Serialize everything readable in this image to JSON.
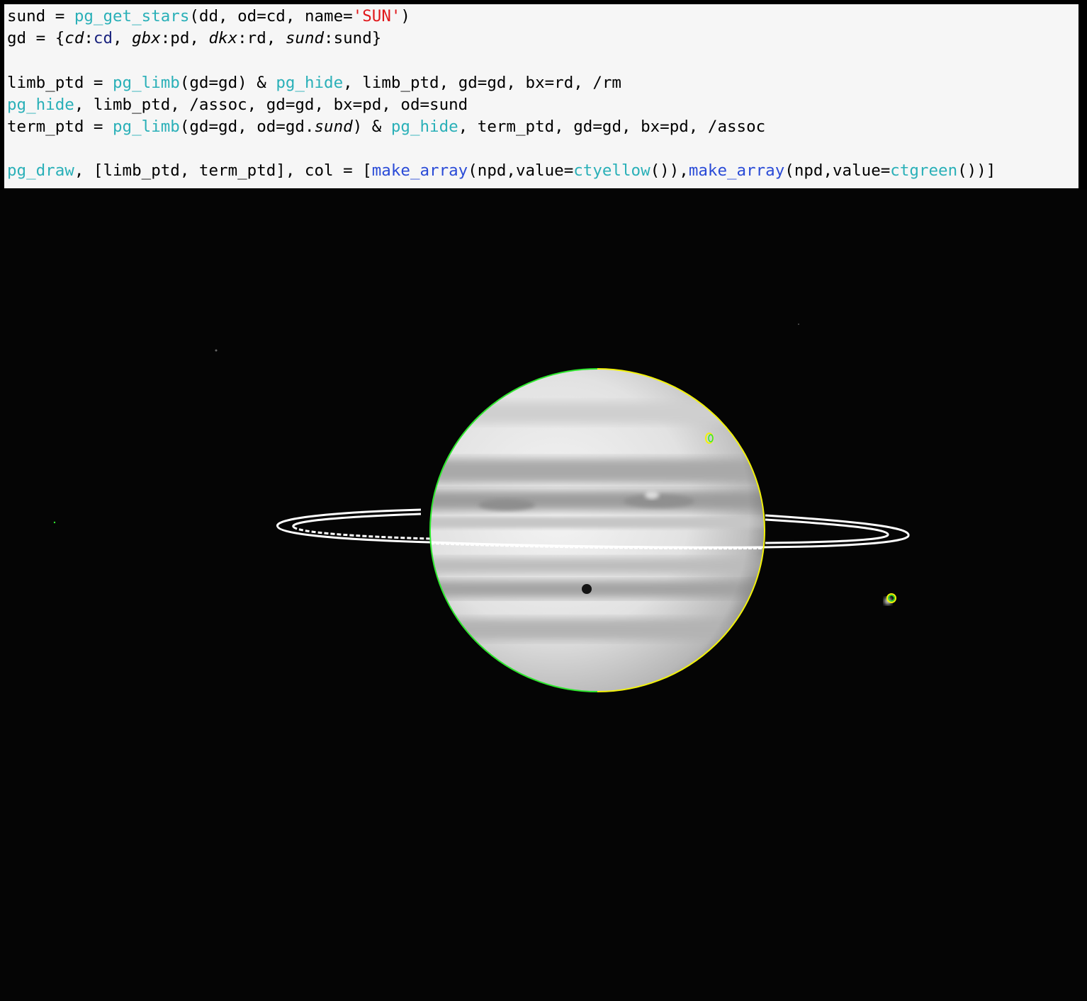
{
  "code": {
    "lines": [
      [
        {
          "t": "sund = ",
          "c": "plain"
        },
        {
          "t": "pg_get_stars",
          "c": "fn"
        },
        {
          "t": "(dd, od=cd, name=",
          "c": "plain"
        },
        {
          "t": "'SUN'",
          "c": "str"
        },
        {
          "t": ")",
          "c": "plain"
        }
      ],
      [
        {
          "t": "gd = {",
          "c": "plain"
        },
        {
          "t": "cd",
          "c": "it"
        },
        {
          "t": ":",
          "c": "plain"
        },
        {
          "t": "cd",
          "c": "var"
        },
        {
          "t": ", ",
          "c": "plain"
        },
        {
          "t": "gbx",
          "c": "it"
        },
        {
          "t": ":pd, ",
          "c": "plain"
        },
        {
          "t": "dkx",
          "c": "it"
        },
        {
          "t": ":rd, ",
          "c": "plain"
        },
        {
          "t": "sund",
          "c": "it"
        },
        {
          "t": ":sund}",
          "c": "plain"
        }
      ],
      [],
      [
        {
          "t": "limb_ptd = ",
          "c": "plain"
        },
        {
          "t": "pg_limb",
          "c": "fn"
        },
        {
          "t": "(gd=gd) & ",
          "c": "plain"
        },
        {
          "t": "pg_hide",
          "c": "fn"
        },
        {
          "t": ", limb_ptd, gd=gd, bx=rd, /rm",
          "c": "plain"
        }
      ],
      [
        {
          "t": "pg_hide",
          "c": "fn"
        },
        {
          "t": ", limb_ptd, /assoc, gd=gd, bx=pd, od=sund",
          "c": "plain"
        }
      ],
      [
        {
          "t": "term_ptd = ",
          "c": "plain"
        },
        {
          "t": "pg_limb",
          "c": "fn"
        },
        {
          "t": "(gd=gd, od=gd.",
          "c": "plain"
        },
        {
          "t": "sund",
          "c": "it"
        },
        {
          "t": ") & ",
          "c": "plain"
        },
        {
          "t": "pg_hide",
          "c": "fn"
        },
        {
          "t": ", term_ptd, gd=gd, bx=pd, /assoc",
          "c": "plain"
        }
      ],
      [],
      [
        {
          "t": "pg_draw",
          "c": "fn"
        },
        {
          "t": ", [limb_ptd, term_ptd], col = [",
          "c": "plain"
        },
        {
          "t": "make_array",
          "c": "kw"
        },
        {
          "t": "(npd,value=",
          "c": "plain"
        },
        {
          "t": "ctyellow",
          "c": "fn"
        },
        {
          "t": "()),",
          "c": "plain"
        },
        {
          "t": "make_array",
          "c": "kw"
        },
        {
          "t": "(npd,value=",
          "c": "plain"
        },
        {
          "t": "ctgreen",
          "c": "fn"
        },
        {
          "t": "())]",
          "c": "plain"
        }
      ]
    ]
  },
  "colors": {
    "limb_outline": "#2ee82e",
    "terminator_outline": "#f2f20a",
    "ring": "#ffffff",
    "background": "#050505",
    "code_background": "#f6f6f6",
    "syntax_function": "#2ab0b8",
    "syntax_string": "#e0181b",
    "syntax_keyword": "#2a4bd7"
  },
  "image": {
    "subject": "planet-with-rings",
    "overlays": [
      "limb-outline-green",
      "terminator-outline-yellow",
      "ring-outline-white",
      "moon-outline"
    ]
  }
}
